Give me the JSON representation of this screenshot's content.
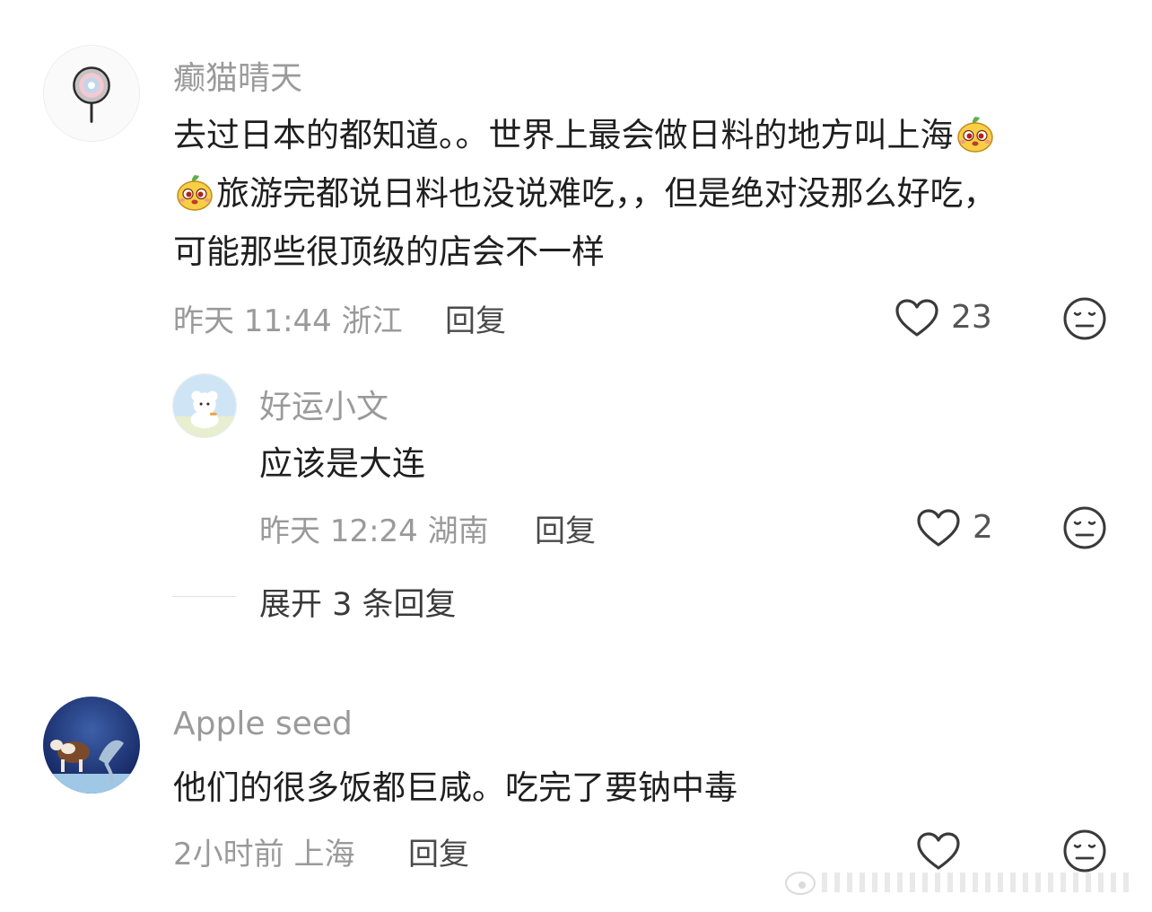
{
  "comments": [
    {
      "username": "癫猫晴天",
      "body_part1": "去过日本的都知道。。世界上最会做日料的地方叫上海",
      "body_part2": "旅游完都说日料也没说难吃，，但是绝对没那么好吃，",
      "body_part3": "可能那些很顶级的店会不一样",
      "meta": "昨天 11:44 浙江",
      "reply_label": "回复",
      "likes": "23"
    },
    {
      "username": "好运小文",
      "body": "应该是大连",
      "meta": "昨天 12:24 湖南",
      "reply_label": "回复",
      "likes": "2"
    },
    {
      "username": "Apple seed",
      "body": "他们的很多饭都巨咸。吃完了要钠中毒",
      "meta": "2小时前 上海",
      "reply_label": "回复"
    }
  ],
  "expand_replies_label": "展开 3 条回复",
  "icons": {
    "like": "heart-outline-icon",
    "dislike": "meh-face-icon",
    "emoji": "yellow-mascot-emoji"
  },
  "colors": {
    "text": "#1f1f1f",
    "secondary": "#9a9a9a",
    "icon": "#3a3a3a"
  }
}
